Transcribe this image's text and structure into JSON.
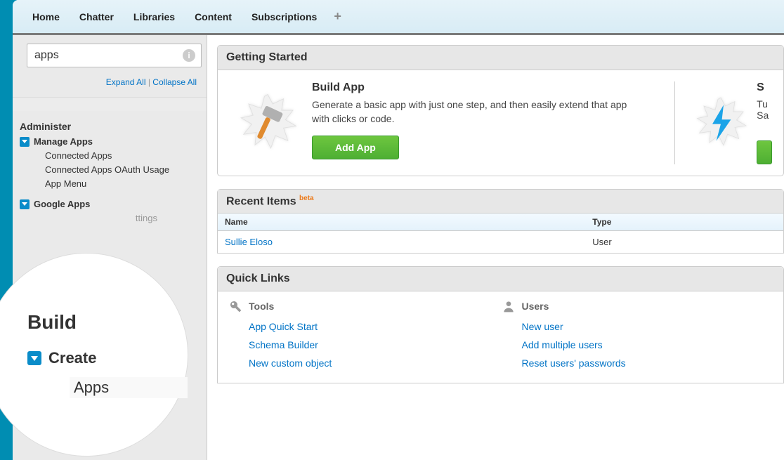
{
  "topnav": {
    "items": [
      "Home",
      "Chatter",
      "Libraries",
      "Content",
      "Subscriptions"
    ]
  },
  "sidebar": {
    "search_value": "apps",
    "expand_all": "Expand All",
    "collapse_all": "Collapse All",
    "section_administer": "Administer",
    "manage_apps": {
      "label": "Manage Apps",
      "items": [
        "Connected Apps",
        "Connected Apps OAuth Usage",
        "App Menu"
      ]
    },
    "google_apps": {
      "label": "Google Apps",
      "trailing": "ttings"
    }
  },
  "magnify": {
    "build": "Build",
    "create": "Create",
    "apps": "Apps"
  },
  "getting_started": {
    "title": "Getting Started",
    "build_title": "Build App",
    "build_desc": "Generate a basic app with just one step, and then easily extend that app with clicks or code.",
    "add_app": "Add App",
    "right_title_initial": "S",
    "right_line1": "Tu",
    "right_line2": "Sa"
  },
  "recent": {
    "title": "Recent Items",
    "beta": "beta",
    "col_name": "Name",
    "col_type": "Type",
    "row_name": "Sullie Eloso",
    "row_type": "User"
  },
  "quicklinks": {
    "title": "Quick Links",
    "tools": {
      "header": "Tools",
      "links": [
        "App Quick Start",
        "Schema Builder",
        "New custom object"
      ]
    },
    "users": {
      "header": "Users",
      "links": [
        "New user",
        "Add multiple users",
        "Reset users' passwords"
      ]
    }
  }
}
